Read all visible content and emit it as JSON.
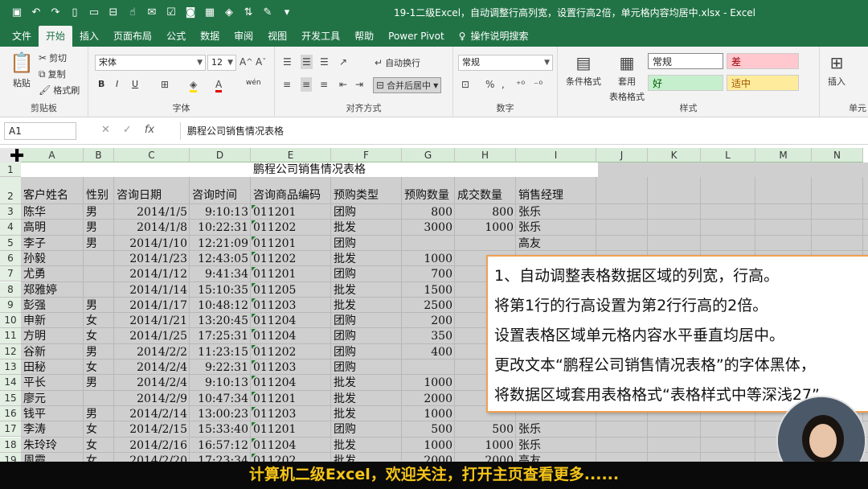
{
  "window": {
    "title": "19-1二级Excel，自动调整行高列宽，设置行高2倍，单元格内容均居中.xlsx  -  Excel"
  },
  "tabs": [
    "文件",
    "开始",
    "插入",
    "页面布局",
    "公式",
    "数据",
    "审阅",
    "视图",
    "开发工具",
    "帮助",
    "Power Pivot"
  ],
  "active_tab": "开始",
  "tell_me": "操作说明搜索",
  "ribbon": {
    "clipboard": {
      "paste": "粘贴",
      "cut": "剪切",
      "copy": "复制",
      "format_painter": "格式刷",
      "label": "剪贴板"
    },
    "font": {
      "name": "宋体",
      "size": "12",
      "label": "字体",
      "bold": "B",
      "italic": "I",
      "underline": "U",
      "wen": "wén"
    },
    "align": {
      "wrap": "自动换行",
      "merge": "合并后居中",
      "label": "对齐方式"
    },
    "number": {
      "format": "常规",
      "label": "数字"
    },
    "styles": {
      "cond": "条件格式",
      "table": "套用",
      "table2": "表格格式",
      "normal": "常规",
      "bad": "差",
      "good": "好",
      "neutral": "适中",
      "label": "样式"
    },
    "cells": {
      "insert": "插入",
      "label": "单元"
    }
  },
  "namebox": "A1",
  "formula": "鹏程公司销售情况表格",
  "columns": [
    "A",
    "B",
    "C",
    "D",
    "E",
    "F",
    "G",
    "H",
    "I",
    "J",
    "K",
    "L",
    "M",
    "N"
  ],
  "title_cell": "鹏程公司销售情况表格",
  "headers": [
    "客户姓名",
    "性别",
    "咨询日期",
    "咨询时间",
    "咨询商品编码",
    "预购类型",
    "预购数量",
    "成交数量",
    "销售经理"
  ],
  "rows": [
    [
      "陈华",
      "男",
      "2014/1/5",
      "9:10:13",
      "011201",
      "团购",
      "800",
      "800",
      "张乐"
    ],
    [
      "高明",
      "男",
      "2014/1/8",
      "10:22:31",
      "011202",
      "批发",
      "3000",
      "1000",
      "张乐"
    ],
    [
      "李子",
      "男",
      "2014/1/10",
      "12:21:09",
      "011201",
      "团购",
      "",
      "",
      "高友"
    ],
    [
      "孙毅",
      "",
      "2014/1/23",
      "12:43:05",
      "011202",
      "批发",
      "1000",
      "",
      ""
    ],
    [
      "尤勇",
      "",
      "2014/1/12",
      "9:41:34",
      "011201",
      "团购",
      "700",
      "",
      ""
    ],
    [
      "郑雅婷",
      "",
      "2014/1/14",
      "15:10:35",
      "011205",
      "批发",
      "1500",
      "",
      ""
    ],
    [
      "彭强",
      "男",
      "2014/1/17",
      "10:48:12",
      "011203",
      "批发",
      "2500",
      "",
      ""
    ],
    [
      "申新",
      "女",
      "2014/1/21",
      "13:20:45",
      "011204",
      "团购",
      "200",
      "",
      ""
    ],
    [
      "方明",
      "女",
      "2014/1/25",
      "17:25:31",
      "011204",
      "团购",
      "350",
      "",
      ""
    ],
    [
      "谷新",
      "男",
      "2014/2/2",
      "11:23:15",
      "011202",
      "团购",
      "400",
      "",
      ""
    ],
    [
      "田秘",
      "女",
      "2014/2/4",
      "9:22:31",
      "011203",
      "团购",
      "",
      "",
      ""
    ],
    [
      "平长",
      "男",
      "2014/2/4",
      "9:10:13",
      "011204",
      "批发",
      "1000",
      "",
      ""
    ],
    [
      "廖元",
      "",
      "2014/2/9",
      "10:47:34",
      "011201",
      "批发",
      "2000",
      "",
      ""
    ],
    [
      "钱平",
      "男",
      "2014/2/14",
      "13:00:23",
      "011203",
      "批发",
      "1000",
      "",
      ""
    ],
    [
      "李涛",
      "女",
      "2014/2/15",
      "15:33:40",
      "011201",
      "团购",
      "500",
      "500",
      "张乐"
    ],
    [
      "朱玲玲",
      "女",
      "2014/2/16",
      "16:57:12",
      "011204",
      "批发",
      "1000",
      "1000",
      "张乐"
    ],
    [
      "周霞",
      "女",
      "2014/2/20",
      "17:23:34",
      "011202",
      "批发",
      "2000",
      "2000",
      "高友"
    ]
  ],
  "row_numbers": [
    "1",
    "2",
    "3",
    "4",
    "5",
    "6",
    "7",
    "8",
    "9",
    "10",
    "11",
    "12",
    "13",
    "14",
    "15",
    "16",
    "17",
    "18",
    "19"
  ],
  "callout": [
    "1、自动调整表格数据区域的列宽，行高。",
    "将第1行的行高设置为第2行行高的2倍。",
    "设置表格区域单元格内容水平垂直均居中。",
    "更改文本“鹏程公司销售情况表格”的字体黑体，",
    "将数据区域套用表格格式“表格样式中等深浅27”"
  ],
  "banner": "计算机二级Excel，欢迎关注，打开主页查看更多......"
}
